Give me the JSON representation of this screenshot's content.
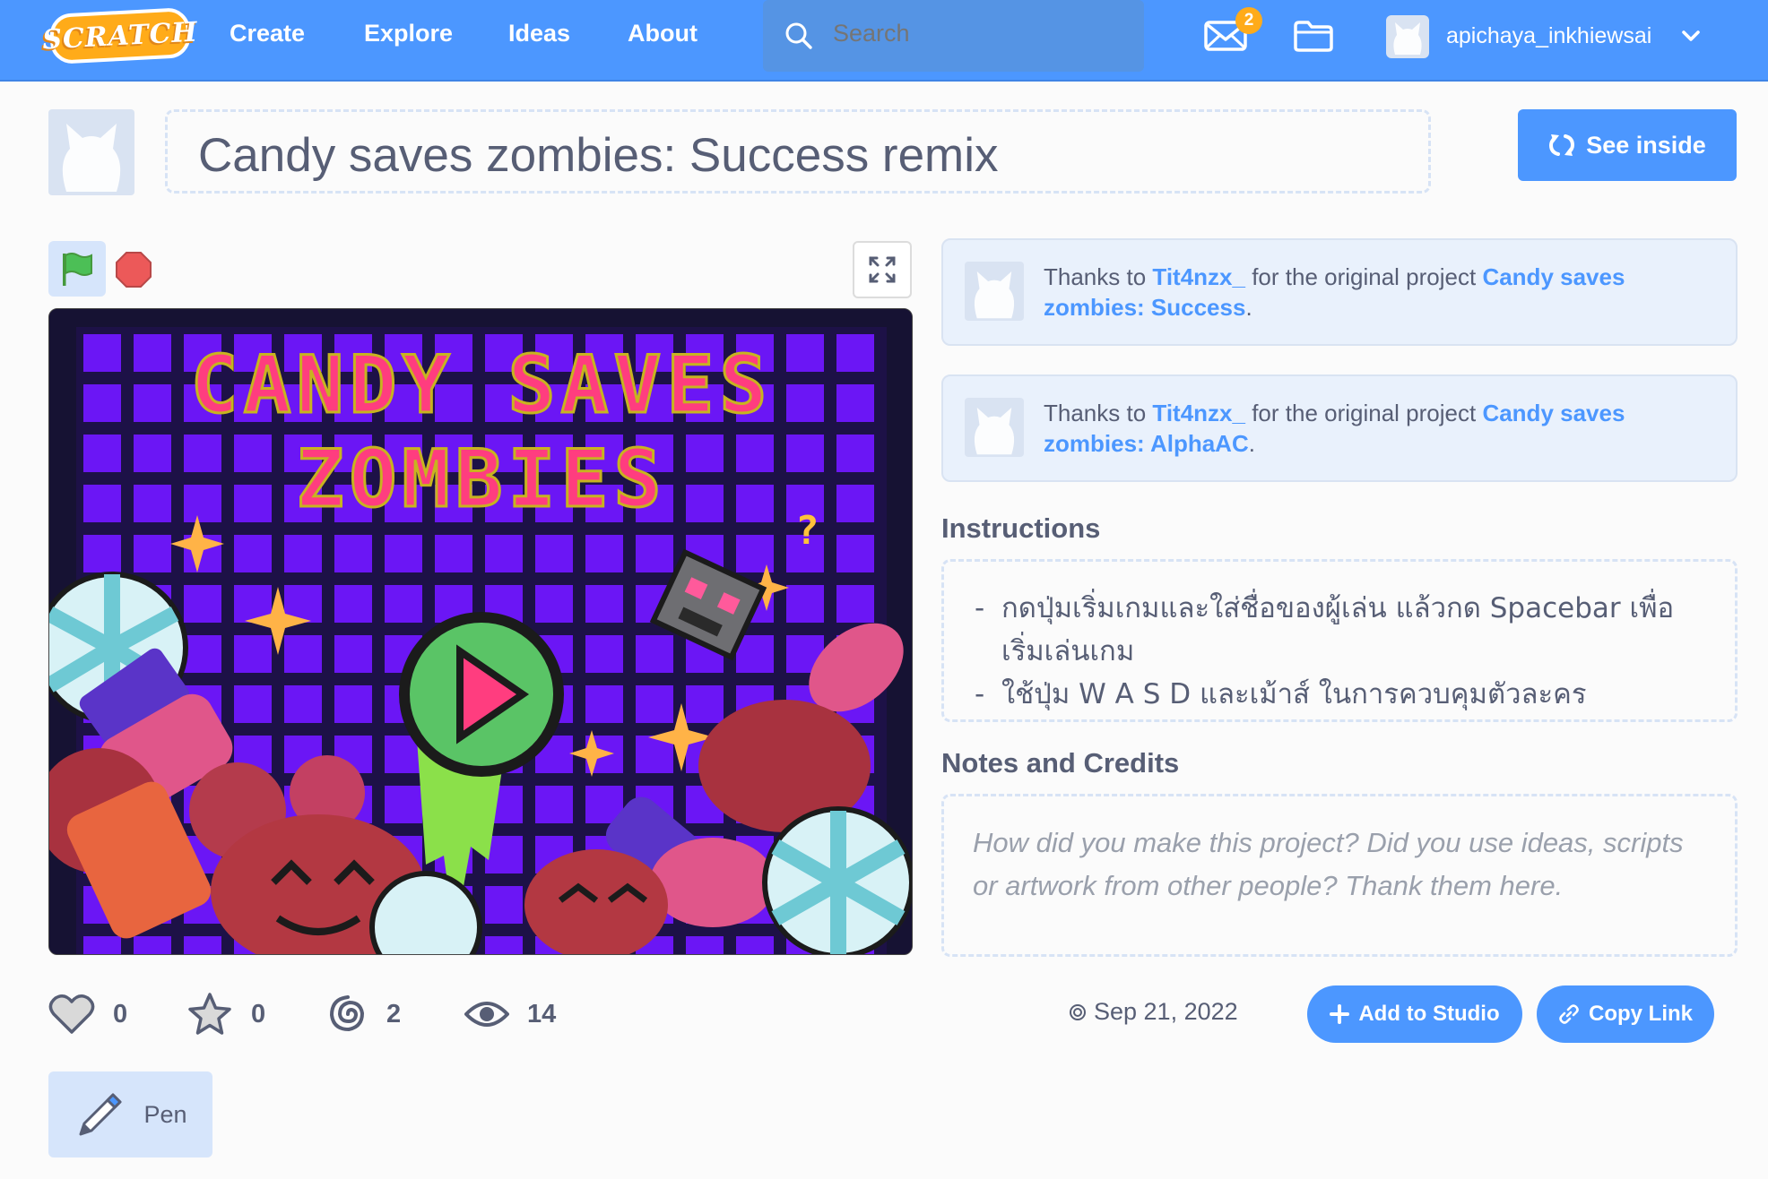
{
  "nav": {
    "logo_text": "SCRATCH",
    "links": [
      "Create",
      "Explore",
      "Ideas",
      "About"
    ],
    "search_placeholder": "Search",
    "messages_count": "2",
    "username": "apichaya_inkhiewsai",
    "icons": [
      "search-icon",
      "mail-icon",
      "folder-icon",
      "chevron-down-icon"
    ]
  },
  "project": {
    "title": "Candy saves zombies: Success remix",
    "see_inside_label": "See inside"
  },
  "stage": {
    "title_line1": "CANDY SAVES",
    "title_line2": "ZOMBIES"
  },
  "credits": [
    {
      "prefix": "Thanks to ",
      "author": "Tit4nzx_",
      "middle": " for the original project ",
      "project": "Candy saves zombies: Success",
      "suffix": "."
    },
    {
      "prefix": "Thanks to ",
      "author": "Tit4nzx_",
      "middle": " for the original project ",
      "project": "Candy saves zombies: AlphaAC",
      "suffix": "."
    }
  ],
  "instructions": {
    "heading": "Instructions",
    "lines": [
      "กดปุ่มเริ่มเกมและใส่ชื่อของผู้เล่น แล้วกด Spacebar เพื่อเริ่มเล่นเกม",
      "ใช้ปุ่ม W A S D และเม้าส์ ในการควบคุมตัวละคร"
    ]
  },
  "notes": {
    "heading": "Notes and Credits",
    "placeholder": "How did you make this project? Did you use ideas, scripts or artwork from other people? Thank them here."
  },
  "stats": {
    "loves": "0",
    "favorites": "0",
    "remixes": "2",
    "views": "14"
  },
  "date": "Sep 21, 2022",
  "actions": {
    "add_to_studio": "Add to Studio",
    "copy_link": "Copy Link"
  },
  "tags": [
    "Pen"
  ],
  "colors": {
    "nav_blue": "#4c97ff",
    "accent_orange": "#ffab19",
    "text": "#575e75",
    "stage_purple": "#6b16f5"
  }
}
